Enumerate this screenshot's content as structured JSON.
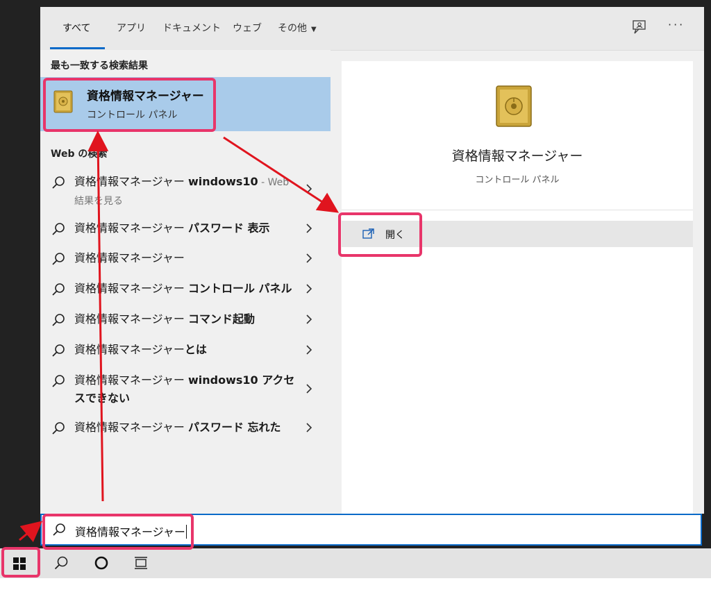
{
  "tabs": [
    {
      "label": "すべて",
      "active": true
    },
    {
      "label": "アプリ"
    },
    {
      "label": "ドキュメント"
    },
    {
      "label": "ウェブ"
    },
    {
      "label": "その他"
    }
  ],
  "toolbar": {
    "more_label": "···",
    "feedback_icon": "feedback-icon"
  },
  "best_match": {
    "section_title": "最も一致する検索結果",
    "name": "資格情報マネージャー",
    "category": "コントロール パネル",
    "icon": "safe-icon"
  },
  "web_search": {
    "section_title": "Web の検索",
    "items": [
      {
        "prefix": "資格情報マネージャー ",
        "suffix": "windows10",
        "extra": " - Web",
        "line2": "結果を見る"
      },
      {
        "prefix": "資格情報マネージャー ",
        "suffix": "パスワード 表示"
      },
      {
        "prefix": "資格情報マネージャー",
        "suffix": ""
      },
      {
        "prefix": "資格情報マネージャー ",
        "suffix": "コントロール パネル"
      },
      {
        "prefix": "資格情報マネージャー ",
        "suffix": "コマンド起動"
      },
      {
        "prefix": "資格情報マネージャー",
        "suffix": "とは"
      },
      {
        "prefix": "資格情報マネージャー ",
        "suffix": "windows10 アクセ",
        "line2_bold": "スできない"
      },
      {
        "prefix": "資格情報マネージャー ",
        "suffix": "パスワード 忘れた"
      }
    ]
  },
  "preview": {
    "title": "資格情報マネージャー",
    "category": "コントロール パネル",
    "open_label": "開く"
  },
  "search": {
    "query": "資格情報マネージャー"
  },
  "colors": {
    "accent": "#0a6ac8",
    "annotation": "#e8356a",
    "arrow": "#e0141e",
    "selected": "#a9cbea"
  }
}
